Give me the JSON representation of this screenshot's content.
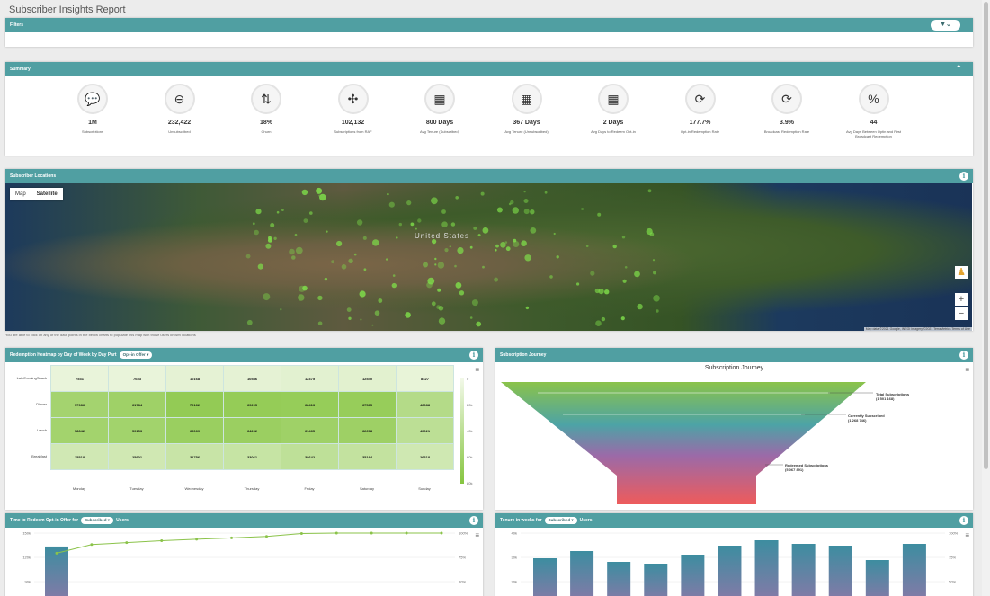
{
  "page": {
    "title": "Subscriber Insights Report"
  },
  "filters": {
    "title": "Filters",
    "toggle_icon": "filter-icon"
  },
  "summary": {
    "title": "Summary",
    "kpis": [
      {
        "value": "1M",
        "label": "Subscriptions",
        "icon": "message-icon",
        "glyph": "💬"
      },
      {
        "value": "232,422",
        "label": "Unsubscribed",
        "icon": "unsubscribe-icon",
        "glyph": "⊖"
      },
      {
        "value": "18%",
        "label": "Churn",
        "icon": "churn-icon",
        "glyph": "⇅"
      },
      {
        "value": "102,132",
        "label": "Subscriptions from RAF",
        "icon": "network-icon",
        "glyph": "✣"
      },
      {
        "value": "800 Days",
        "label": "Avg Tenure (Subscribed)",
        "icon": "calendar-icon",
        "glyph": "▦"
      },
      {
        "value": "367 Days",
        "label": "Avg Tenure (Unsubscribed)",
        "icon": "calendar-icon",
        "glyph": "▦"
      },
      {
        "value": "2 Days",
        "label": "Avg Days to Redeem Opt-in",
        "icon": "calendar-icon",
        "glyph": "▦"
      },
      {
        "value": "177.7%",
        "label": "Opt-in Redemption Rate",
        "icon": "refresh-icon",
        "glyph": "⟳"
      },
      {
        "value": "3.9%",
        "label": "Broadcast Redemption Rate",
        "icon": "refresh-icon",
        "glyph": "⟳"
      },
      {
        "value": "44",
        "label": "Avg Days Between Optin and First Broadcast Redemption",
        "icon": "percent-icon",
        "glyph": "%"
      }
    ]
  },
  "locations": {
    "title": "Subscriber Locations",
    "map_tab": "Map",
    "satellite_tab": "Satellite",
    "country_label": "United States",
    "credit": "Map data ©2021 Google, INEGI Imagery ©2021 TerraMetrics  Terms of Use",
    "note": "You are able to click on any of the data points in the below charts to populate this map with those users known locations"
  },
  "heatmap": {
    "title": "Redemption Heatmap by Day of Week by Day Part",
    "dropdown": "Opt-in Offer",
    "rows": [
      "LateEveningSnack",
      "Dinner",
      "Lunch",
      "Breakfast"
    ],
    "columns": [
      "Monday",
      "Tuesday",
      "Wednesday",
      "Thursday",
      "Friday",
      "Saturday",
      "Sunday"
    ],
    "values": [
      [
        7531,
        7653,
        10168,
        10586,
        12375,
        12540,
        8427
      ],
      [
        57986,
        61784,
        70162,
        69295,
        68413,
        67585,
        46088
      ],
      [
        58642,
        59153,
        65069,
        64262,
        61465,
        62678,
        40021
      ],
      [
        25518,
        25901,
        31756,
        33061,
        38642,
        35164,
        26318
      ]
    ],
    "scale_labels": [
      "0",
      "20k",
      "40k",
      "60k",
      "80k"
    ],
    "low_color": "#f3f9ea",
    "high_color": "#86c540"
  },
  "journey": {
    "title": "Subscription Journey",
    "chart_title": "Subscription Journey",
    "stages": [
      {
        "label": "Total Subscriptions",
        "value": "(1 501 168)"
      },
      {
        "label": "Currently Subscribed",
        "value": "(1 268 746)"
      },
      {
        "label": "Redeemed Subscriptions",
        "value": "(5 067 891)"
      }
    ]
  },
  "redeem": {
    "title_prefix": "Time to Redeem Opt-in Offer for",
    "dropdown": "Subscribed",
    "title_suffix": "Users",
    "y_left": [
      "150k",
      "120k",
      "90k"
    ],
    "y_right": [
      "100%",
      "75%",
      "50%"
    ]
  },
  "tenure": {
    "title_prefix": "Tenure in weeks for",
    "dropdown": "Subscribed",
    "title_suffix": "Users",
    "y_left": [
      "40k",
      "30k",
      "20k"
    ],
    "y_right": [
      "100%",
      "75%",
      "50%"
    ]
  },
  "chart_data": [
    {
      "type": "line",
      "title": "Time to Redeem Opt-in Offer for Subscribed Users",
      "series": [
        {
          "values": [
            108000,
            126000,
            130000,
            134000,
            137000,
            140000,
            143000,
            149000,
            150000,
            150000,
            150000,
            150000
          ]
        }
      ],
      "bars": [
        122000
      ]
    },
    {
      "type": "bar",
      "title": "Tenure in weeks for Subscribed Users",
      "values": [
        26,
        30,
        24,
        23,
        28,
        33,
        36,
        34,
        33,
        25,
        34
      ],
      "ylim": [
        0,
        40
      ]
    }
  ]
}
